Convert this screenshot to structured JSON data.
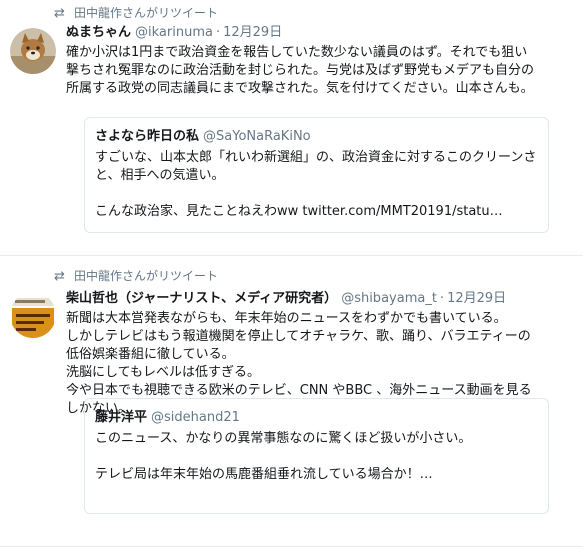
{
  "tweets": [
    {
      "retweet_icon": "retweet-icon",
      "retweeted_by": "田中龍作さんがリツイート",
      "avatar": "dog-avatar",
      "name": "ぬまちゃん",
      "handle": "@ikarinuma",
      "sep": "·",
      "time": "12月29日",
      "lines": [
        "確か小沢は1円まで政治資金を報告していた数少ない議員のはず。それでも狙い",
        "撃ちされ冤罪なのに政治活動を封じられた。与党は及ばず野党もメデアも自分の",
        "所属する政党の同志議員にまで攻撃された。気を付けてください。山本さんも。"
      ],
      "quote": {
        "name": "さよなら昨日の私",
        "handle": "@SaYoNaRaKiNo",
        "lines": [
          "すごいな、山本太郎「れいわ新選組」の、政治資金に対するこのクリーンさ",
          "と、相手への気遣い。",
          "こんな政治家、見たことねえわww twitter.com/MMT20191/statu…"
        ]
      }
    },
    {
      "retweet_icon": "retweet-icon",
      "retweeted_by": "田中龍作さんがリツイート",
      "avatar": "book-cover-avatar",
      "name": "柴山哲也（ジャーナリスト、メディア研究者）",
      "handle": "@shibayama_t",
      "sep": "·",
      "time": "12月29日",
      "lines": [
        "新聞は大本営発表ながらも、年末年始のニュースをわずかでも書いている。",
        "しかしテレビはもう報道機関を停止してオチャラケ、歌、踊り、バラエティーの",
        "低俗娯楽番組に徹している。",
        "洗脳にしてもレベルは低すぎる。",
        "今や日本でも視聴できる欧米のテレビ、CNN やBBC 、海外ニュース動画を見る",
        "しかない。"
      ],
      "quote": {
        "name": "藤井洋平",
        "handle": "@sidehand21",
        "lines": [
          "このニュース、かなりの異常事態なのに驚くほど扱いが小さい。",
          "テレビ局は年末年始の馬鹿番組垂れ流している場合か！…"
        ]
      }
    }
  ]
}
